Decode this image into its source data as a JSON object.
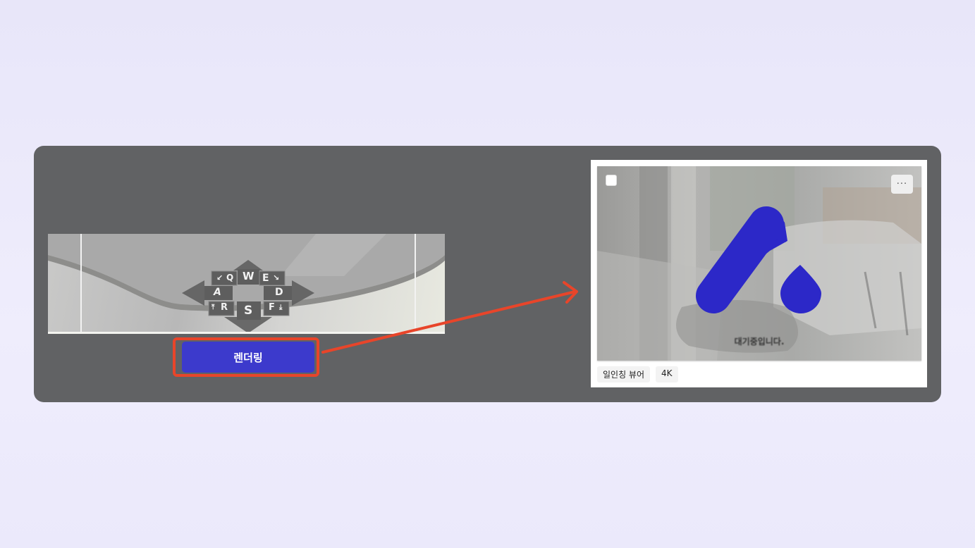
{
  "viewer": {
    "keys": {
      "w": "W",
      "q": "Q",
      "e": "E",
      "a": "A",
      "d": "D",
      "r": "R",
      "s": "S",
      "f": "F",
      "q_arrow": "↙",
      "e_arrow": "↘",
      "r_arrow": "⤒",
      "f_arrow": "⤓"
    }
  },
  "render_button": {
    "label": "렌더링"
  },
  "result": {
    "status": "대기중입니다.",
    "more_label": "···",
    "tags": [
      "일인칭 뷰어",
      "4K"
    ]
  },
  "colors": {
    "accent": "#3c3acc",
    "highlight": "#e8452a",
    "logo": "#2c28c8",
    "panel": "#616264"
  }
}
